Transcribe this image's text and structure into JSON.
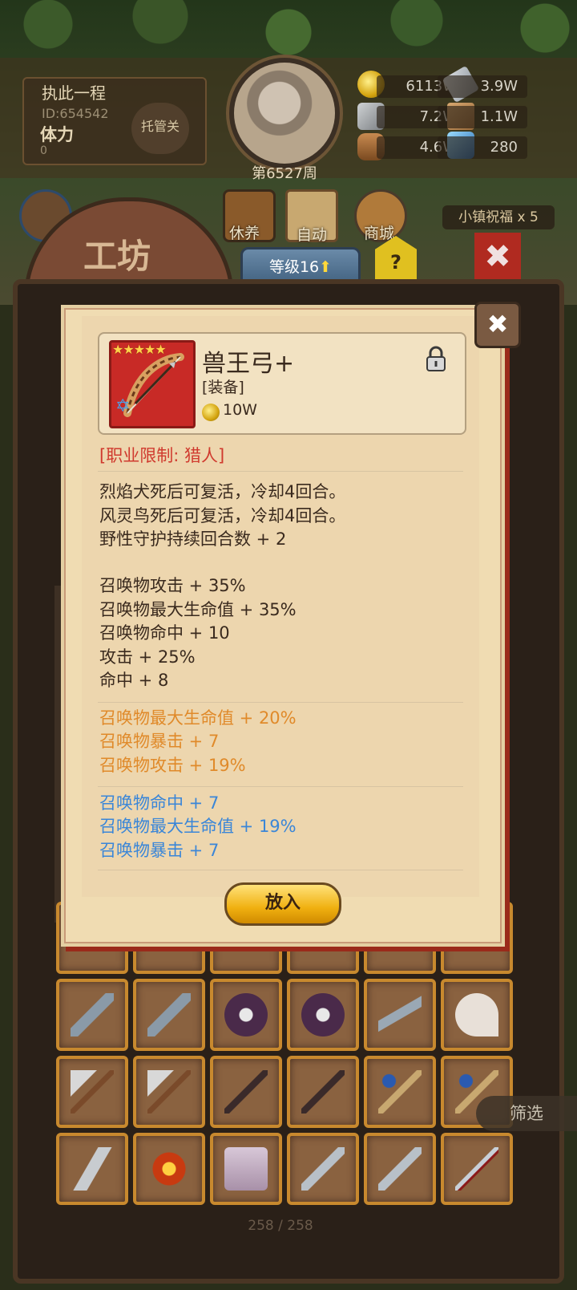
{
  "player": {
    "name": "执此一程",
    "id": "ID:654542",
    "stamina_label": "体力",
    "stamina_value": "0",
    "auto_label": "托管关",
    "week": "第6527周"
  },
  "resources": [
    {
      "icon": "gold-coin-icon",
      "value": "6113W"
    },
    {
      "icon": "iron-ingot-icon",
      "value": "3.9W"
    },
    {
      "icon": "stone-icon",
      "value": "7.2W"
    },
    {
      "icon": "leather-icon",
      "value": "1.1W"
    },
    {
      "icon": "wood-log-icon",
      "value": "4.6W"
    },
    {
      "icon": "crystal-icon",
      "value": "280"
    }
  ],
  "nav": {
    "rest_label": "休养",
    "auto_label": "自动",
    "shop_label": "商城",
    "bless_label": "小镇祝福 x 5"
  },
  "workshop": {
    "title": "工坊",
    "level_label": "等级16",
    "help_label": "?",
    "close_label": "✖"
  },
  "inventory": {
    "filter_label": "筛选",
    "count": "258 / 258"
  },
  "item": {
    "name": "兽王弓+",
    "type": "[装备]",
    "price": "10W",
    "stars": "★★★★★",
    "class_requirement": "[职业限制: 猎人]",
    "fixed_effects": [
      "烈焰犬死后可复活，冷却4回合。",
      "风灵鸟死后可复活，冷却4回合。",
      "野性守护持续回合数 + 2",
      "召唤物攻击 + 35%",
      "召唤物最大生命值 + 35%",
      "召唤物命中 + 10",
      "攻击 + 25%",
      "命中 + 8"
    ],
    "orange_effects": [
      "召唤物最大生命值 + 20%",
      "召唤物暴击 + 7",
      "召唤物攻击 + 19%"
    ],
    "blue_effects": [
      "召唤物命中 + 7",
      "召唤物最大生命值 + 19%",
      "召唤物暴击 + 7"
    ],
    "put_in_label": "放入"
  },
  "colors": {
    "requirement": "#d03a2e",
    "orange_affix": "#e08a2a",
    "blue_affix": "#3a86d8",
    "button_gold": "#f0b010"
  }
}
